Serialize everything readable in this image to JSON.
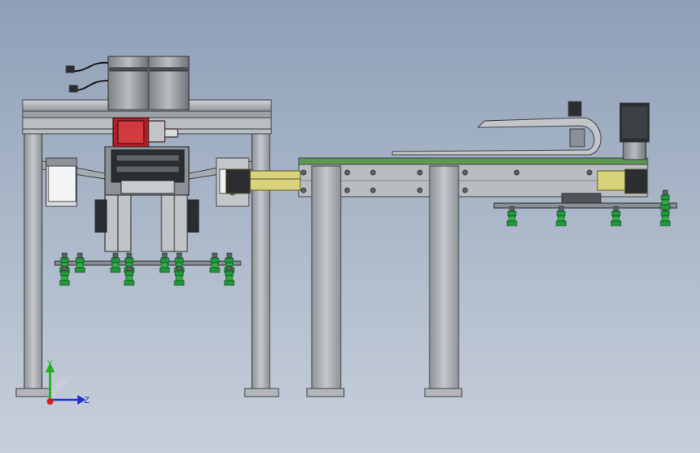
{
  "viewport": {
    "type": "CAD assembly drawing (side view)",
    "background_top": "#8f9fb7",
    "background_bottom": "#c7cfda"
  },
  "triad": {
    "y_label": "Y",
    "z_label": "Z",
    "y_color": "#1fb01f",
    "z_color": "#1f2fd0",
    "origin_color": "#d01f1f"
  },
  "colors": {
    "frame": "#a8adb3",
    "frame_dark": "#5c6166",
    "motor_red": "#b22025",
    "suction_green": "#1f9a3a",
    "conveyor_top": "#5c9a52",
    "rail_yellow": "#d8d27a",
    "dark_part": "#2b2d30"
  },
  "suction_cups": {
    "left_group_count": 12,
    "right_group_count": 5
  }
}
